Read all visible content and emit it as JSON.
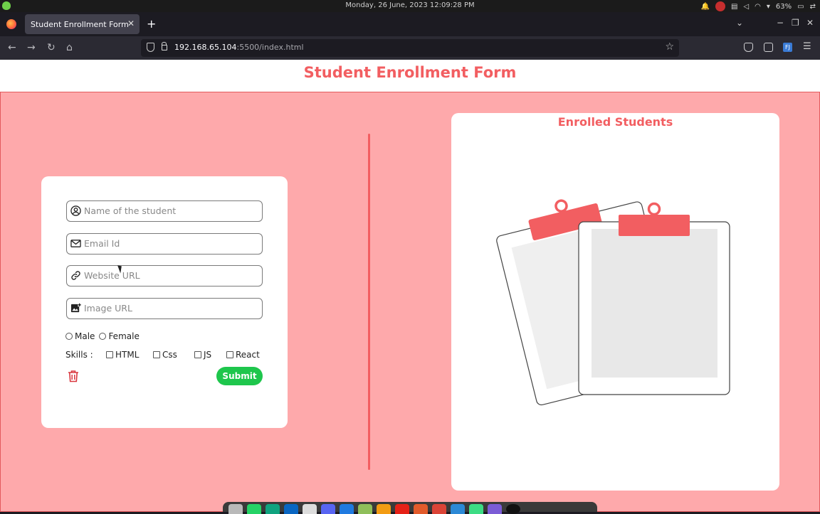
{
  "system": {
    "clock": "Monday, 26 June, 2023  12:09:28 PM",
    "battery": "63%"
  },
  "browser": {
    "tab_title": "Student Enrollment Form",
    "url_host": "192.168.65.104",
    "url_rest": ":5500/index.html",
    "ext_badge": "FJ"
  },
  "page": {
    "title": "Student Enrollment Form"
  },
  "form": {
    "name_placeholder": "Name of the student",
    "email_placeholder": "Email Id",
    "website_placeholder": "Website URL",
    "image_placeholder": "Image URL",
    "gender_options": [
      "Male",
      "Female"
    ],
    "skills_label": "Skills :",
    "skills": [
      "HTML",
      "Css",
      "JS",
      "React"
    ],
    "submit_label": "Submit"
  },
  "enrolled": {
    "title": "Enrolled Students"
  },
  "colors": {
    "accent": "#f25e61",
    "background_pink": "#fea9ab",
    "submit_green": "#1ec64c",
    "trash_red": "#d9363e"
  },
  "dock": {
    "apps": [
      "files",
      "whatsapp",
      "chatgpt",
      "linkedin",
      "inkscape",
      "discord",
      "intellij",
      "maps",
      "vlc",
      "youtube",
      "notes",
      "chrome",
      "vscode",
      "android-studio",
      "app",
      "github"
    ]
  }
}
